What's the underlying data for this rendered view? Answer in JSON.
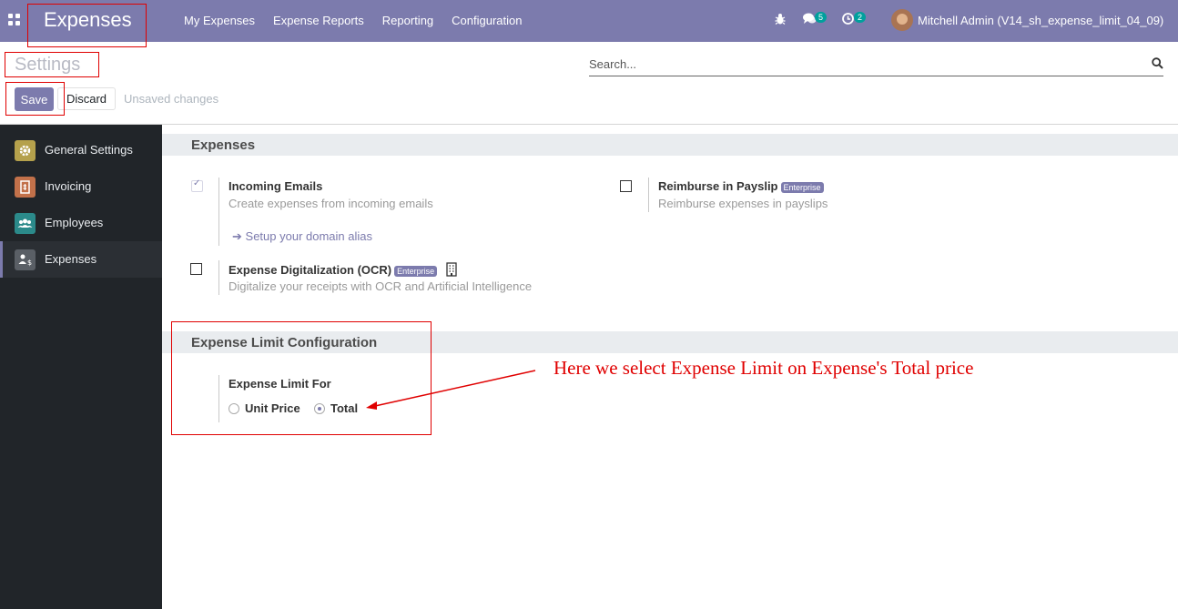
{
  "navbar": {
    "app_title": "Expenses",
    "menu": [
      "My Expenses",
      "Expense Reports",
      "Reporting",
      "Configuration"
    ],
    "messages_count": "5",
    "activities_count": "2",
    "user_name": "Mitchell Admin (V14_sh_expense_limit_04_09)",
    "icons": [
      "apps-icon",
      "bug-icon",
      "chat-icon",
      "clock-icon"
    ]
  },
  "control_panel": {
    "title": "Settings",
    "search_placeholder": "Search...",
    "save_label": "Save",
    "discard_label": "Discard",
    "status_text": "Unsaved changes"
  },
  "sidebar": {
    "items": [
      {
        "label": "General Settings",
        "icon": "gear-icon",
        "color": "#b5a14c"
      },
      {
        "label": "Invoicing",
        "icon": "invoice-icon",
        "color": "#c2714a"
      },
      {
        "label": "Employees",
        "icon": "users-icon",
        "color": "#2b8a8a"
      },
      {
        "label": "Expenses",
        "icon": "expense-icon",
        "color": "#5a5f66"
      }
    ],
    "active": "Expenses"
  },
  "expenses_section": {
    "heading": "Expenses",
    "incoming_emails": {
      "title": "Incoming Emails",
      "description": "Create expenses from incoming emails",
      "checked": true,
      "link": "Setup your domain alias"
    },
    "reimburse_payslip": {
      "title": "Reimburse in Payslip",
      "badge": "Enterprise",
      "description": "Reimburse expenses in payslips",
      "checked": false
    },
    "ocr": {
      "title": "Expense Digitalization (OCR)",
      "badge": "Enterprise",
      "description": "Digitalize your receipts with OCR and Artificial Intelligence",
      "checked": false
    }
  },
  "limit_section": {
    "heading": "Expense Limit Configuration",
    "field_label": "Expense Limit For",
    "options": [
      "Unit Price",
      "Total"
    ],
    "selected": "Total"
  },
  "annotation": {
    "text": "Here we select Expense Limit on Expense's Total price",
    "color": "#e00000"
  },
  "colors": {
    "brand": "#7c7bad",
    "sidebar_bg": "#212529",
    "section_bg": "#e9ecef"
  }
}
